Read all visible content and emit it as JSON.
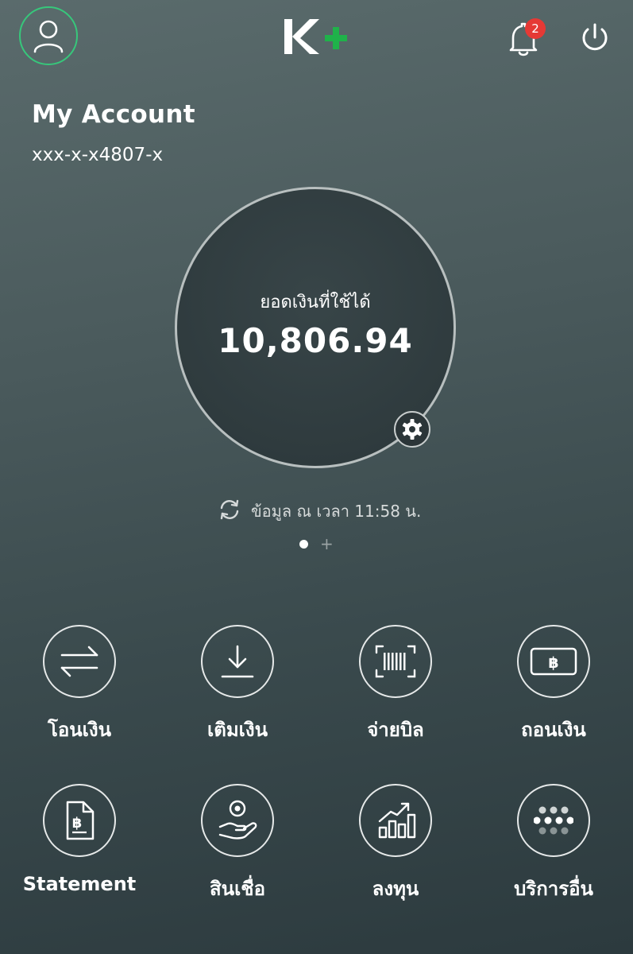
{
  "header": {
    "logo": {
      "letter": "K",
      "plus": "+"
    },
    "notification_count": "2",
    "icons": [
      "user-icon",
      "bell-icon",
      "power-icon"
    ]
  },
  "account": {
    "title": "My Account",
    "number": "xxx-x-x4807-x"
  },
  "balance": {
    "label": "ยอดเงินที่ใช้ได้",
    "value": "10,806.94"
  },
  "updated_text": "ข้อมูล ณ เวลา 11:58 น.",
  "pager": {
    "plus": "+"
  },
  "actions": [
    {
      "label": "โอนเงิน",
      "icon": "transfer-icon"
    },
    {
      "label": "เติมเงิน",
      "icon": "topup-download-icon"
    },
    {
      "label": "จ่ายบิล",
      "icon": "barcode-icon"
    },
    {
      "label": "ถอนเงิน",
      "icon": "cash-withdraw-icon"
    },
    {
      "label": "Statement",
      "icon": "statement-icon"
    },
    {
      "label": "สินเชื่อ",
      "icon": "loan-icon"
    },
    {
      "label": "ลงทุน",
      "icon": "invest-chart-icon"
    },
    {
      "label": "บริการอื่น",
      "icon": "more-services-icon"
    }
  ],
  "colors": {
    "accent_green": "#37c77b",
    "logo_green": "#1fb24a",
    "badge_red": "#e53935"
  }
}
